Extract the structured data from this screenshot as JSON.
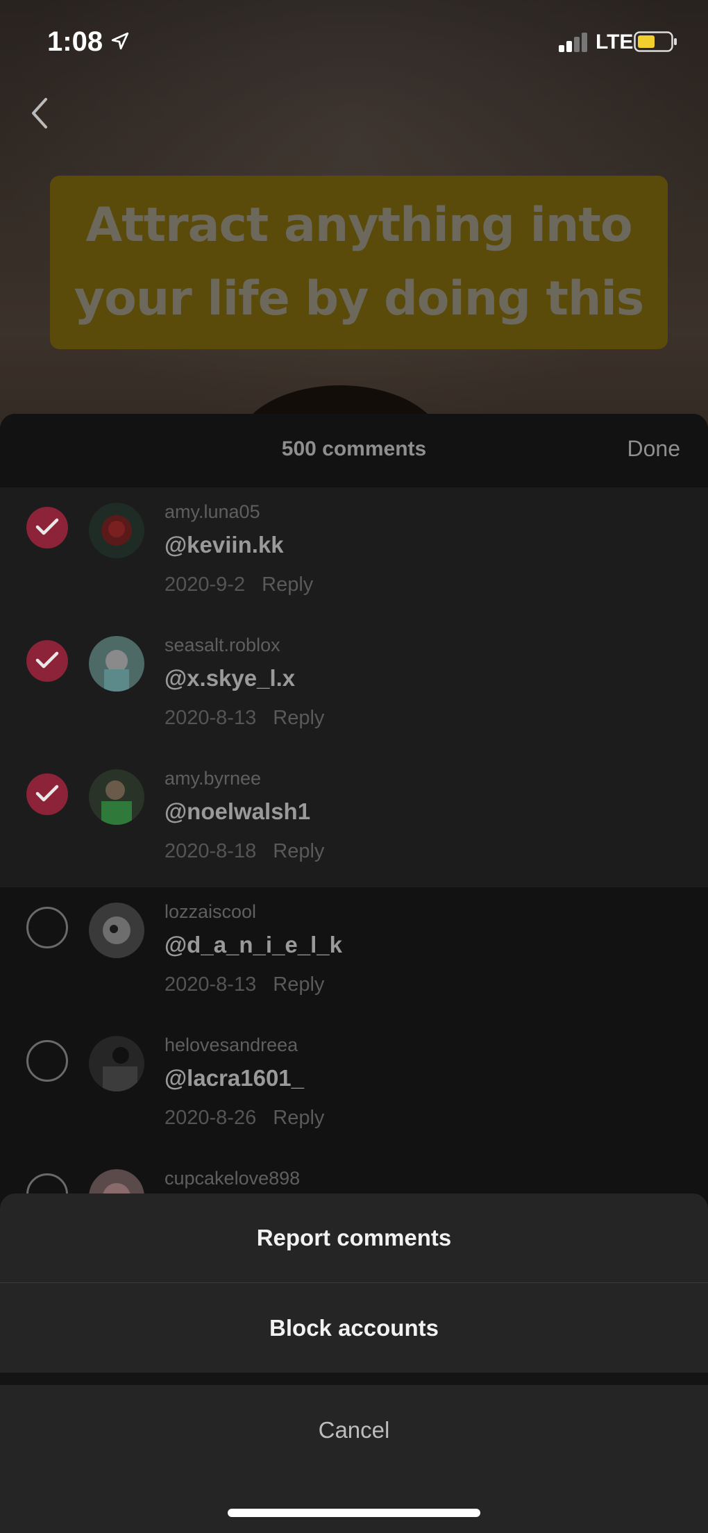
{
  "status_bar": {
    "time": "1:08",
    "network": "LTE"
  },
  "video": {
    "caption": "Attract anything into your life by doing this"
  },
  "comments_panel": {
    "count_label": "500 comments",
    "done_label": "Done"
  },
  "comments": [
    {
      "username": "amy.luna05",
      "text": "@keviin.kk",
      "date": "2020-9-2",
      "reply": "Reply",
      "selected": true
    },
    {
      "username": "seasalt.roblox",
      "text": "@x.skye_l.x",
      "date": "2020-8-13",
      "reply": "Reply",
      "selected": true
    },
    {
      "username": "amy.byrnee",
      "text": "@noelwalsh1",
      "date": "2020-8-18",
      "reply": "Reply",
      "selected": true
    },
    {
      "username": "lozzaiscool",
      "text": "@d_a_n_i_e_l_k",
      "date": "2020-8-13",
      "reply": "Reply",
      "selected": false
    },
    {
      "username": "helovesandreea",
      "text": "@lacra1601_",
      "date": "2020-8-26",
      "reply": "Reply",
      "selected": false
    },
    {
      "username": "cupcakelove898",
      "text": "",
      "date": "",
      "reply": "",
      "selected": false
    }
  ],
  "action_sheet": {
    "report_label": "Report comments",
    "block_label": "Block accounts",
    "cancel_label": "Cancel"
  },
  "colors": {
    "checked": "#8c2338",
    "caption_bg": "#8a7412",
    "sheet_bg": "#121212",
    "action_bg": "#252525"
  }
}
